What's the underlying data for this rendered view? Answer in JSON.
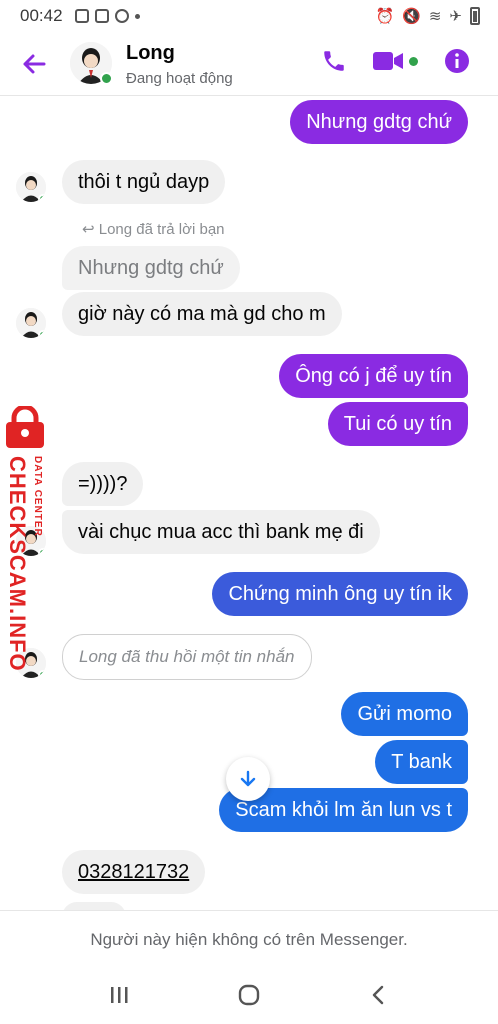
{
  "status_bar": {
    "time": "00:42"
  },
  "header": {
    "contact_name": "Long",
    "contact_status": "Đang hoạt động",
    "accent_color": "#8a2be2"
  },
  "messages": [
    {
      "id": "m1",
      "dir": "out",
      "text": "Nhưng gdtg chứ"
    },
    {
      "id": "m2",
      "dir": "in",
      "text": "thôi t ngủ dayp"
    },
    {
      "id": "m3",
      "dir": "note",
      "text": "Long đã trả lời bạn"
    },
    {
      "id": "m4",
      "dir": "quote",
      "text": "Nhưng gdtg chứ"
    },
    {
      "id": "m5",
      "dir": "in",
      "text": "giờ này có ma mà gd cho m"
    },
    {
      "id": "m6",
      "dir": "out",
      "text": "Ông có j để uy tín"
    },
    {
      "id": "m7",
      "dir": "out",
      "text": "Tui có uy tín"
    },
    {
      "id": "m8",
      "dir": "in",
      "text": "=))))?"
    },
    {
      "id": "m9",
      "dir": "in",
      "text": "vài chục mua acc thì bank mẹ đi"
    },
    {
      "id": "m10",
      "dir": "out",
      "text": "Chứng minh ông uy tín ik"
    },
    {
      "id": "m11",
      "dir": "recalled",
      "text": "Long đã thu hồi một tin nhắn"
    },
    {
      "id": "m12",
      "dir": "out",
      "text": "Gửi momo"
    },
    {
      "id": "m13",
      "dir": "out",
      "text": "T bank"
    },
    {
      "id": "m14",
      "dir": "out",
      "text": "Scam khỏi lm ăn lun vs t"
    },
    {
      "id": "m15",
      "dir": "in",
      "text": "0328121732"
    }
  ],
  "watermark": {
    "main": "CHECKSCAM.INFO",
    "sub": "DATA CENTER"
  },
  "footer": {
    "notice": "Người này hiện không có trên Messenger."
  },
  "icons": [
    "back-arrow-icon",
    "phone-icon",
    "video-icon",
    "info-icon",
    "arrow-down-icon",
    "recent-apps-icon",
    "home-icon",
    "nav-back-icon",
    "lock-icon"
  ]
}
